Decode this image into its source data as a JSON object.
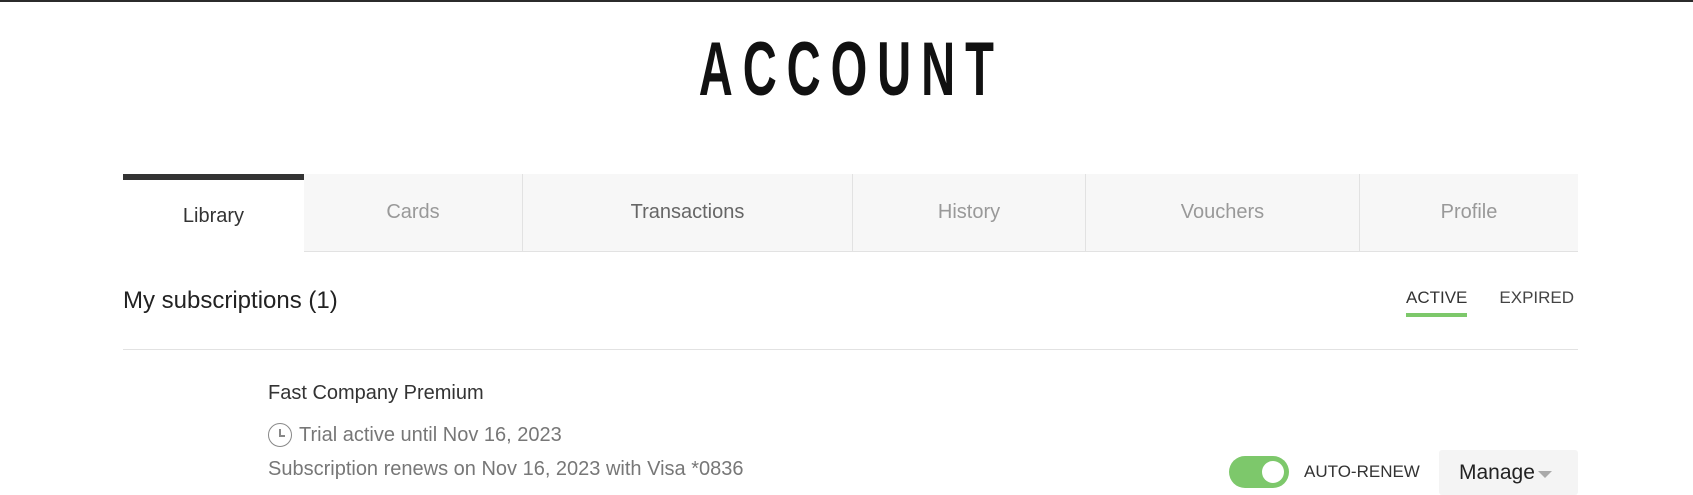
{
  "header": {
    "title": "ACCOUNT"
  },
  "tabs": [
    {
      "label": "Library",
      "active": true
    },
    {
      "label": "Cards"
    },
    {
      "label": "Transactions"
    },
    {
      "label": "History"
    },
    {
      "label": "Vouchers"
    },
    {
      "label": "Profile"
    }
  ],
  "subscriptions": {
    "title": "My subscriptions (1)",
    "filters": {
      "active": "ACTIVE",
      "expired": "EXPIRED"
    },
    "items": [
      {
        "name": "Fast Company Premium",
        "trial": "Trial active until Nov 16, 2023",
        "renewal": "Subscription renews on Nov 16, 2023 with Visa *0836",
        "auto_renew_label": "AUTO-RENEW",
        "auto_renew_on": true,
        "manage_label": "Manage"
      }
    ]
  },
  "colors": {
    "accent": "#7dc86b",
    "tab_active_bar": "#333333"
  },
  "icons": {
    "trial": "clock-icon",
    "manage": "chevron-down-icon"
  }
}
